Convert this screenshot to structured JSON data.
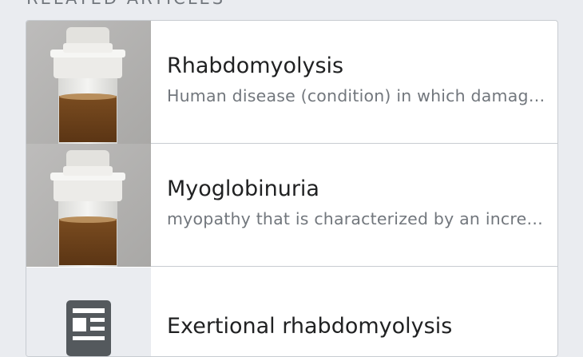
{
  "section": {
    "header": "RELATED ARTICLES"
  },
  "articles": [
    {
      "title": "Rhabdomyolysis",
      "description": "Human disease (condition) in which damaged skeletal muscle breaks down rapidly",
      "thumbnail": "urine-sample-photo"
    },
    {
      "title": "Myoglobinuria",
      "description": "myopathy that is characterized by an increase of myoglobin in the urine",
      "thumbnail": "urine-sample-photo"
    },
    {
      "title": "Exertional rhabdomyolysis",
      "description": "",
      "thumbnail": "document-icon"
    }
  ],
  "colors": {
    "background": "#eaecf0",
    "card": "#ffffff",
    "border": "#c8ccd1",
    "title_text": "#202122",
    "secondary_text": "#72777d",
    "icon": "#54595d"
  }
}
